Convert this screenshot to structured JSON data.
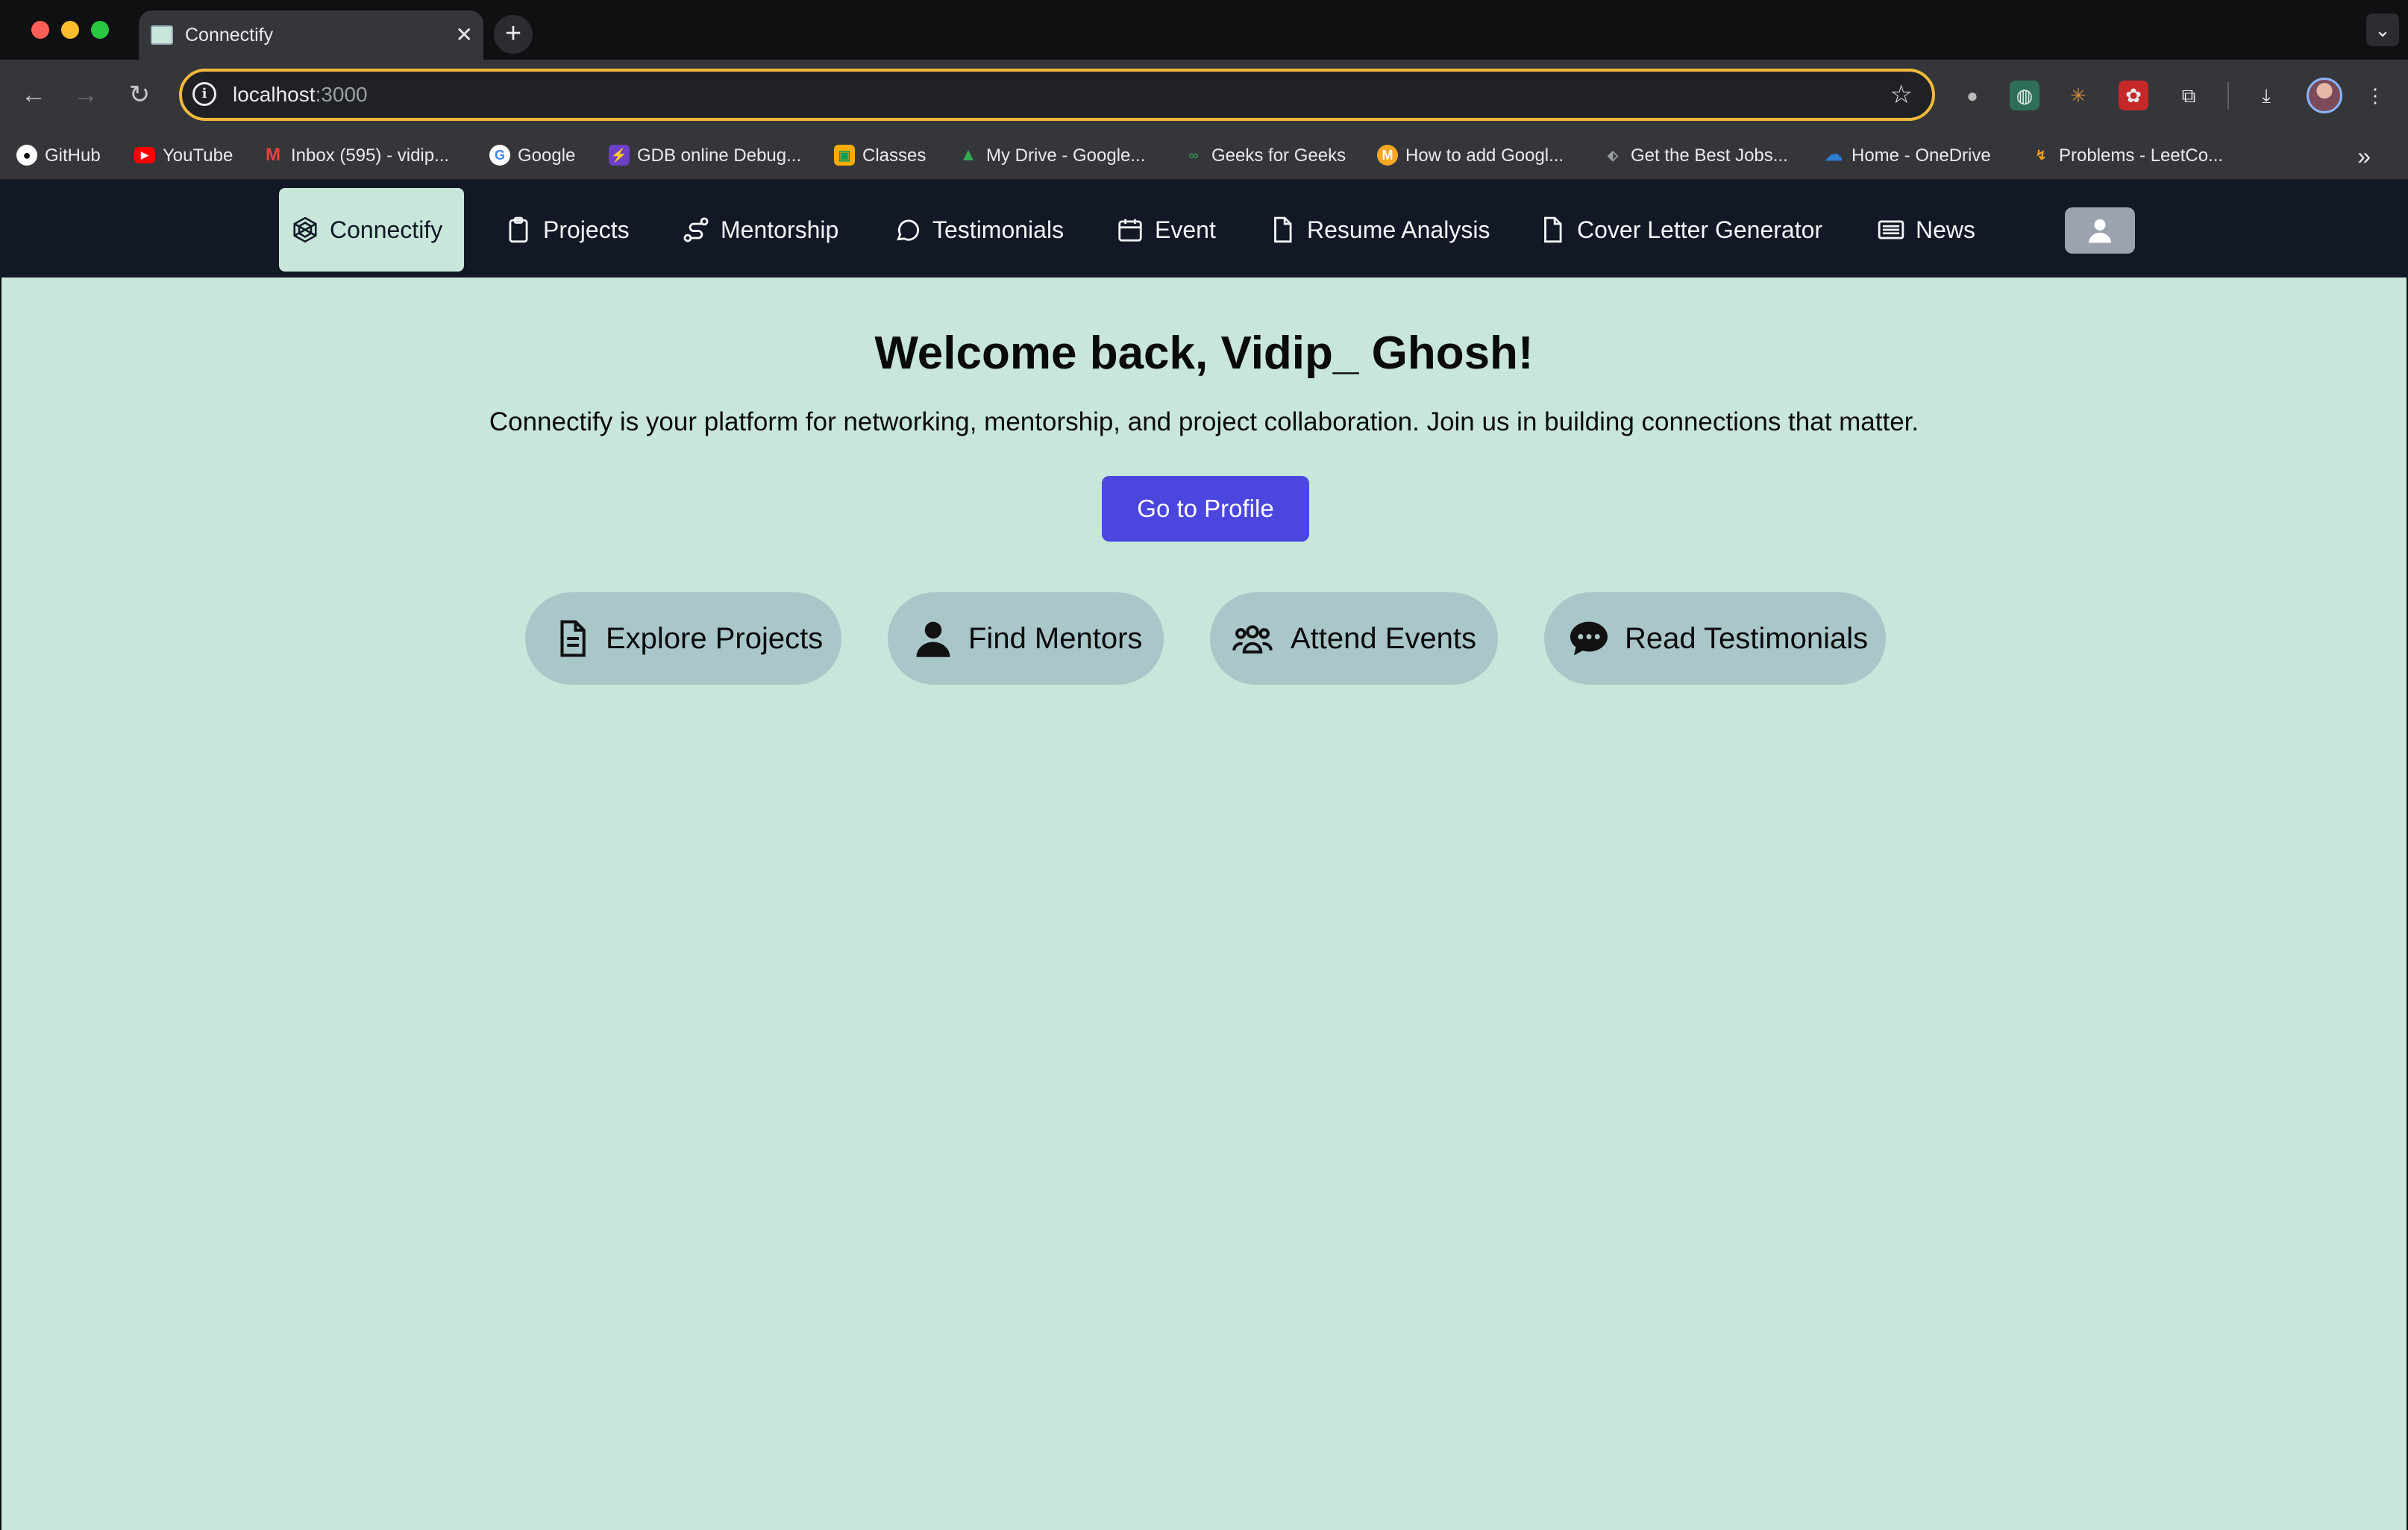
{
  "browser": {
    "tab_title": "Connectify",
    "url_host": "localhost",
    "url_port": ":3000",
    "bookmarks": [
      {
        "label": "GitHub",
        "icon": "github-icon",
        "color": "#ffffff"
      },
      {
        "label": "YouTube",
        "icon": "youtube-icon",
        "color": "#ff0000"
      },
      {
        "label": "Inbox (595) - vidip...",
        "icon": "gmail-icon",
        "color": "#ea4335"
      },
      {
        "label": "Google",
        "icon": "google-icon",
        "color": "#4285f4"
      },
      {
        "label": "GDB online Debug...",
        "icon": "gdb-icon",
        "color": "#6c3fc7"
      },
      {
        "label": "Classes",
        "icon": "classroom-icon",
        "color": "#f9ab00"
      },
      {
        "label": "My Drive - Google...",
        "icon": "drive-icon",
        "color": "#34a853"
      },
      {
        "label": "Geeks for Geeks",
        "icon": "gfg-icon",
        "color": "#2f8d46"
      },
      {
        "label": "How to add Googl...",
        "icon": "medium-icon",
        "color": "#f5a623"
      },
      {
        "label": "Get the Best Jobs...",
        "icon": "jobs-icon",
        "color": "#6b7280"
      },
      {
        "label": "Home - OneDrive",
        "icon": "onedrive-icon",
        "color": "#2b7cd3"
      },
      {
        "label": "Problems - LeetCo...",
        "icon": "leetcode-icon",
        "color": "#ffa116"
      }
    ]
  },
  "nav": {
    "brand": "Connectify",
    "items": [
      {
        "label": "Projects",
        "icon": "clipboard-icon"
      },
      {
        "label": "Mentorship",
        "icon": "route-icon"
      },
      {
        "label": "Testimonials",
        "icon": "chat-bubble-icon"
      },
      {
        "label": "Event",
        "icon": "calendar-icon"
      },
      {
        "label": "Resume Analysis",
        "icon": "file-icon"
      },
      {
        "label": "Cover Letter Generator",
        "icon": "file-icon"
      },
      {
        "label": "News",
        "icon": "newspaper-icon"
      }
    ]
  },
  "hero": {
    "title": "Welcome back, Vidip_ Ghosh!",
    "subtitle": "Connectify is your platform for networking, mentorship, and project collaboration. Join us in building connections that matter.",
    "profile_button": "Go to Profile"
  },
  "actions": [
    {
      "label": "Explore Projects",
      "icon": "document-icon"
    },
    {
      "label": "Find Mentors",
      "icon": "user-icon"
    },
    {
      "label": "Attend Events",
      "icon": "users-icon"
    },
    {
      "label": "Read Testimonials",
      "icon": "comment-dots-icon"
    }
  ],
  "colors": {
    "main_bg": "#c8e6da",
    "navbar_bg": "#121826",
    "primary_button": "#4b46dd",
    "action_pill": "#a9c6c9"
  }
}
